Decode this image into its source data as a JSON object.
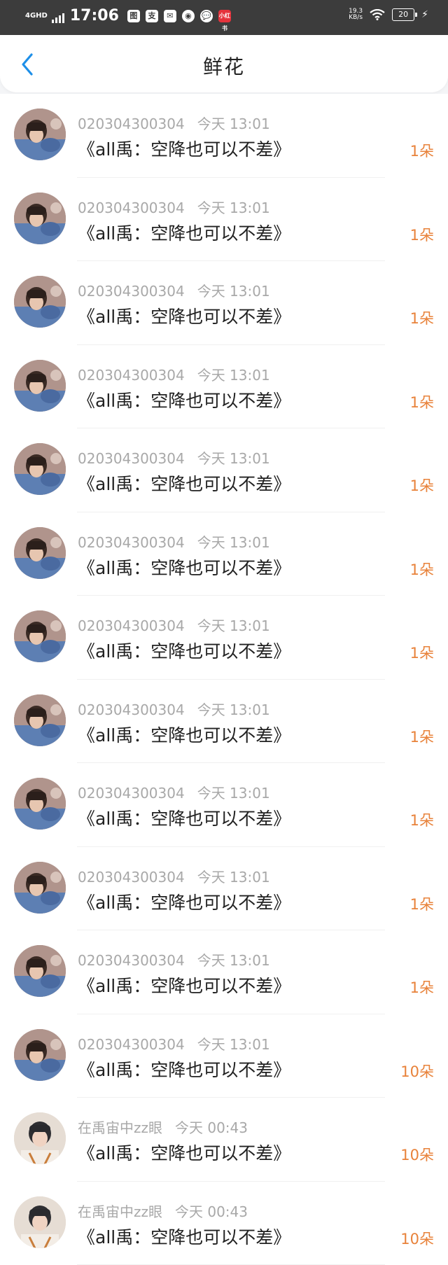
{
  "status_bar": {
    "network": "4GHD",
    "time": "17:06",
    "app_icons": [
      "图",
      "支",
      "✉",
      "◉",
      "💬",
      "小红书"
    ],
    "speed": "19.3",
    "speed_unit": "KB/s",
    "battery": "20"
  },
  "header": {
    "title": "鲜花"
  },
  "rows": [
    {
      "user": "020304300304",
      "time": "今天 13:01",
      "title": "《all禹：空降也可以不差》",
      "count": "1朵",
      "avatar": "avatar-boy-blue"
    },
    {
      "user": "020304300304",
      "time": "今天 13:01",
      "title": "《all禹：空降也可以不差》",
      "count": "1朵",
      "avatar": "avatar-boy-blue"
    },
    {
      "user": "020304300304",
      "time": "今天 13:01",
      "title": "《all禹：空降也可以不差》",
      "count": "1朵",
      "avatar": "avatar-boy-blue"
    },
    {
      "user": "020304300304",
      "time": "今天 13:01",
      "title": "《all禹：空降也可以不差》",
      "count": "1朵",
      "avatar": "avatar-boy-blue"
    },
    {
      "user": "020304300304",
      "time": "今天 13:01",
      "title": "《all禹：空降也可以不差》",
      "count": "1朵",
      "avatar": "avatar-boy-blue"
    },
    {
      "user": "020304300304",
      "time": "今天 13:01",
      "title": "《all禹：空降也可以不差》",
      "count": "1朵",
      "avatar": "avatar-boy-blue"
    },
    {
      "user": "020304300304",
      "time": "今天 13:01",
      "title": "《all禹：空降也可以不差》",
      "count": "1朵",
      "avatar": "avatar-boy-blue"
    },
    {
      "user": "020304300304",
      "time": "今天 13:01",
      "title": "《all禹：空降也可以不差》",
      "count": "1朵",
      "avatar": "avatar-boy-blue"
    },
    {
      "user": "020304300304",
      "time": "今天 13:01",
      "title": "《all禹：空降也可以不差》",
      "count": "1朵",
      "avatar": "avatar-boy-blue"
    },
    {
      "user": "020304300304",
      "time": "今天 13:01",
      "title": "《all禹：空降也可以不差》",
      "count": "1朵",
      "avatar": "avatar-boy-blue"
    },
    {
      "user": "020304300304",
      "time": "今天 13:01",
      "title": "《all禹：空降也可以不差》",
      "count": "1朵",
      "avatar": "avatar-boy-blue"
    },
    {
      "user": "020304300304",
      "time": "今天 13:01",
      "title": "《all禹：空降也可以不差》",
      "count": "10朵",
      "avatar": "avatar-boy-blue"
    },
    {
      "user": "在禹宙中zz眼",
      "time": "今天 00:43",
      "title": "《all禹：空降也可以不差》",
      "count": "10朵",
      "avatar": "avatar-boy-light"
    },
    {
      "user": "在禹宙中zz眼",
      "time": "今天 00:43",
      "title": "《all禹：空降也可以不差》",
      "count": "10朵",
      "avatar": "avatar-boy-light"
    }
  ],
  "colors": {
    "accent": "#1e8fe8",
    "count": "#e8823a",
    "meta": "#a8a8a8"
  }
}
